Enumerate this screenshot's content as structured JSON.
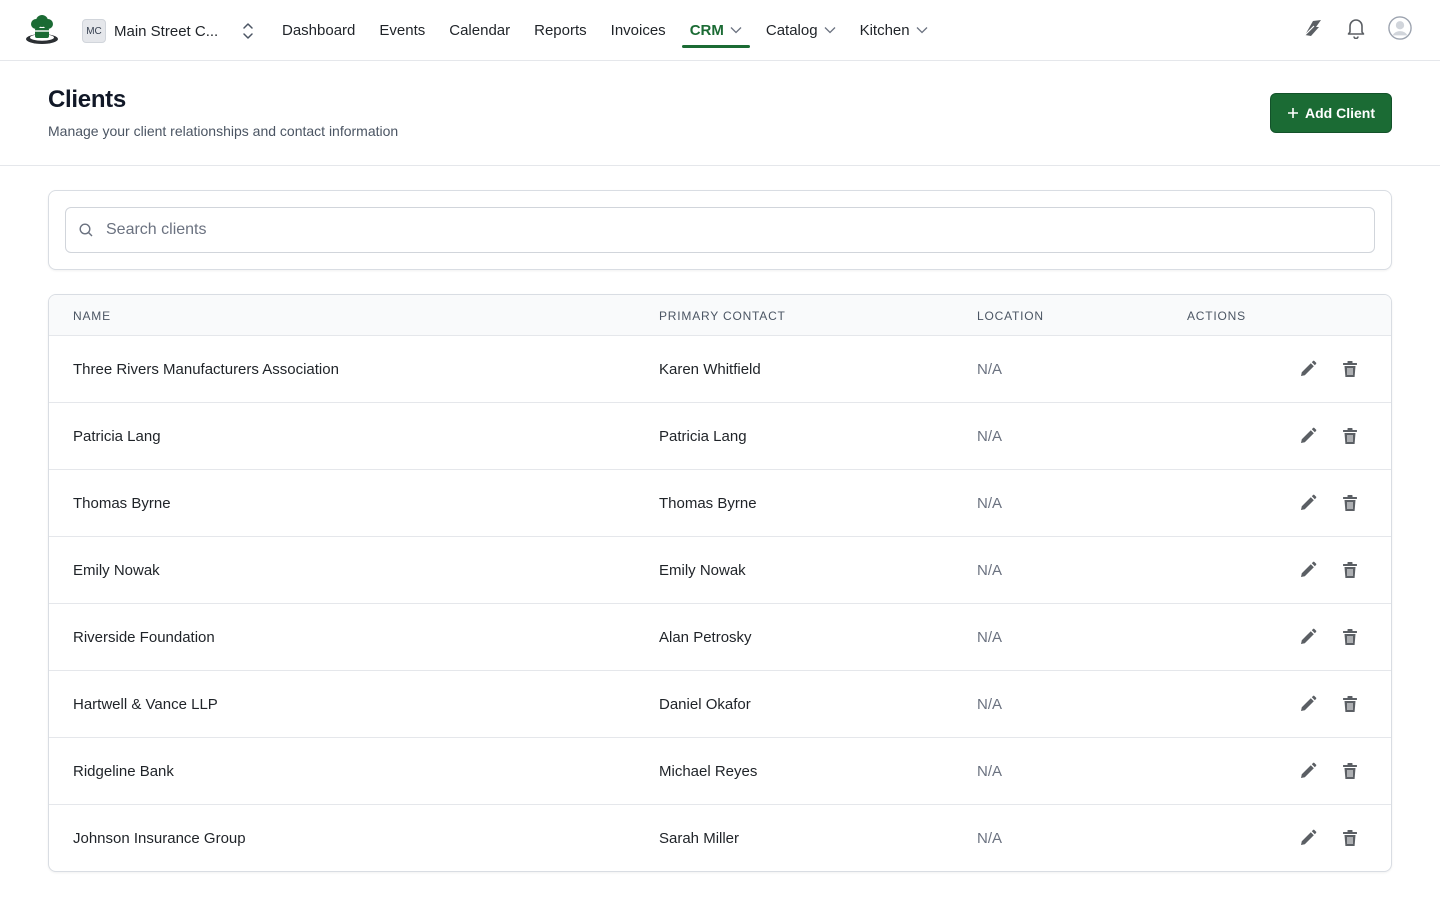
{
  "nav": {
    "org_badge": "MC",
    "org_name": "Main Street C...",
    "links": [
      {
        "label": "Dashboard",
        "dropdown": false,
        "active": false
      },
      {
        "label": "Events",
        "dropdown": false,
        "active": false
      },
      {
        "label": "Calendar",
        "dropdown": false,
        "active": false
      },
      {
        "label": "Reports",
        "dropdown": false,
        "active": false
      },
      {
        "label": "Invoices",
        "dropdown": false,
        "active": false
      },
      {
        "label": "CRM",
        "dropdown": true,
        "active": true
      },
      {
        "label": "Catalog",
        "dropdown": true,
        "active": false
      },
      {
        "label": "Kitchen",
        "dropdown": true,
        "active": false
      }
    ],
    "right_icons": [
      "feather-icon",
      "bell-icon",
      "user-avatar-icon"
    ]
  },
  "header": {
    "title": "Clients",
    "subtitle": "Manage your client relationships and contact information",
    "add_button": "Add Client"
  },
  "search": {
    "placeholder": "Search clients",
    "value": ""
  },
  "table": {
    "headers": {
      "name": "NAME",
      "contact": "PRIMARY CONTACT",
      "location": "LOCATION",
      "actions": "ACTIONS"
    },
    "rows": [
      {
        "name": "Three Rivers Manufacturers Association",
        "contact": "Karen Whitfield",
        "location": "N/A"
      },
      {
        "name": "Patricia Lang",
        "contact": "Patricia Lang",
        "location": "N/A"
      },
      {
        "name": "Thomas Byrne",
        "contact": "Thomas Byrne",
        "location": "N/A"
      },
      {
        "name": "Emily Nowak",
        "contact": "Emily Nowak",
        "location": "N/A"
      },
      {
        "name": "Riverside Foundation",
        "contact": "Alan Petrosky",
        "location": "N/A"
      },
      {
        "name": "Hartwell & Vance LLP",
        "contact": "Daniel Okafor",
        "location": "N/A"
      },
      {
        "name": "Ridgeline Bank",
        "contact": "Michael Reyes",
        "location": "N/A"
      },
      {
        "name": "Johnson Insurance Group",
        "contact": "Sarah Miller",
        "location": "N/A"
      }
    ]
  },
  "colors": {
    "brand": "#1b6b34",
    "border": "#e5e7eb",
    "muted_text": "#6b7280"
  }
}
